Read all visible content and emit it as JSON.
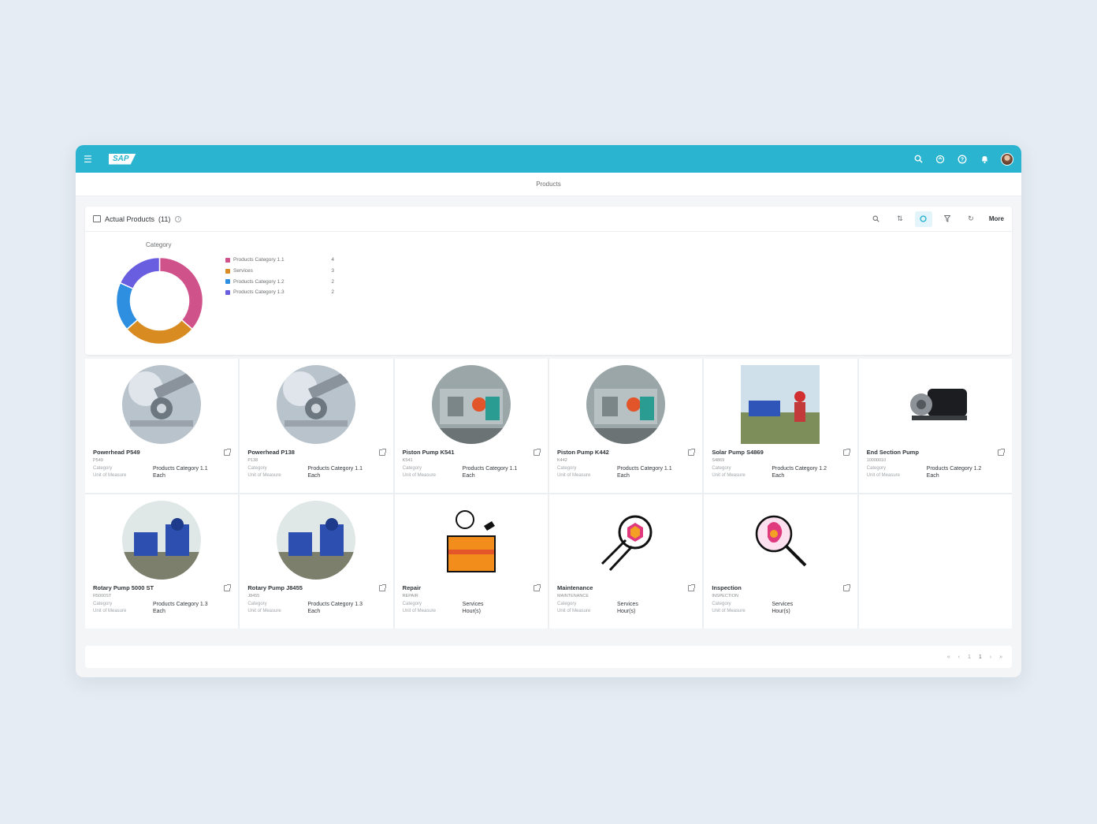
{
  "shellbar": {
    "logo": "SAP",
    "icons": [
      "menu-icon",
      "search-icon",
      "sync-icon",
      "help-icon",
      "notification-icon",
      "avatar"
    ]
  },
  "page": {
    "title": "Products"
  },
  "panel": {
    "title": "Actual Products",
    "count": "(11)",
    "toolbar": {
      "more_label": "More"
    }
  },
  "chart_data": {
    "type": "pie",
    "title": "Category",
    "categories": [
      "Products Category 1.1",
      "Services",
      "Products Category 1.2",
      "Products Category 1.3"
    ],
    "values": [
      4,
      3,
      2,
      2
    ],
    "colors": [
      "#d0528a",
      "#d88b20",
      "#2e8fe0",
      "#6a5ee0"
    ],
    "donut": true
  },
  "cards": [
    {
      "title": "Powerhead P549",
      "id": "P549",
      "category_label": "Category",
      "category": "Products Category 1.1",
      "uom_label": "Unit of Measure",
      "uom": "Each",
      "image": "powerhead-photo"
    },
    {
      "title": "Powerhead P138",
      "id": "P138",
      "category_label": "Category",
      "category": "Products Category 1.1",
      "uom_label": "Unit of Measure",
      "uom": "Each",
      "image": "powerhead-photo"
    },
    {
      "title": "Piston Pump K541",
      "id": "K541",
      "category_label": "Category",
      "category": "Products Category 1.1",
      "uom_label": "Unit of Measure",
      "uom": "Each",
      "image": "piston-pump-photo"
    },
    {
      "title": "Piston Pump K442",
      "id": "K442",
      "category_label": "Category",
      "category": "Products Category 1.1",
      "uom_label": "Unit of Measure",
      "uom": "Each",
      "image": "piston-pump-photo"
    },
    {
      "title": "Solar Pump S4869",
      "id": "S4869",
      "category_label": "Category",
      "category": "Products Category 1.2",
      "uom_label": "Unit of Measure",
      "uom": "Each",
      "image": "solar-pump-photo"
    },
    {
      "title": "End Section Pump",
      "id": "10000010",
      "category_label": "Category",
      "category": "Products Category 1.2",
      "uom_label": "Unit of Measure",
      "uom": "Each",
      "image": "end-section-pump-photo"
    },
    {
      "title": "Rotary Pump 5000 ST",
      "id": "R5000ST",
      "category_label": "Category",
      "category": "Products Category 1.3",
      "uom_label": "Unit of Measure",
      "uom": "Each",
      "image": "rotary-pump-photo"
    },
    {
      "title": "Rotary Pump J8455",
      "id": "J8455",
      "category_label": "Category",
      "category": "Products Category 1.3",
      "uom_label": "Unit of Measure",
      "uom": "Each",
      "image": "rotary-pump-photo"
    },
    {
      "title": "Repair",
      "id": "REPAIR",
      "category_label": "Category",
      "category": "Services",
      "uom_label": "Unit of Measure",
      "uom": "Hour(s)",
      "image": "repair-illustration"
    },
    {
      "title": "Maintenance",
      "id": "MAINTENANCE",
      "category_label": "Category",
      "category": "Services",
      "uom_label": "Unit of Measure",
      "uom": "Hour(s)",
      "image": "maintenance-illustration"
    },
    {
      "title": "Inspection",
      "id": "INSPECTION",
      "category_label": "Category",
      "category": "Services",
      "uom_label": "Unit of Measure",
      "uom": "Hour(s)",
      "image": "inspection-illustration"
    }
  ],
  "pagination": {
    "page": "1"
  }
}
